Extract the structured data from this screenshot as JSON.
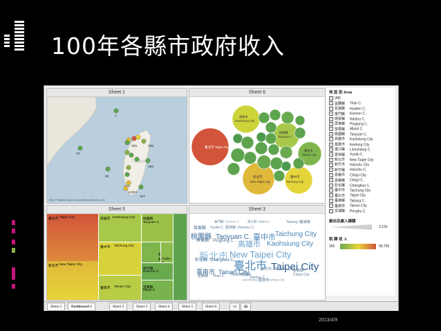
{
  "slide": {
    "title": "100年各縣市政府收入",
    "date": "2013/4/9"
  },
  "sheets": {
    "map": {
      "title": "Sheet 1",
      "labels": [
        "7",
        "43",
        "328",
        "335",
        "286",
        "50",
        "425",
        "2,834",
        "197"
      ],
      "watermark": "TAIWAN",
      "attribution": "Albert Tableau maps: www.tableausoftware.com"
    },
    "bubbles": {
      "title": "Sheet 6",
      "labels": [
        {
          "zh": "臺北市",
          "en": "Taipei City"
        },
        {
          "zh": "高雄市",
          "en": "Kaohsiung City"
        },
        {
          "zh": "桃園縣",
          "en": "Taoyuan C."
        },
        {
          "zh": "臺南市",
          "en": "Tainan City"
        },
        {
          "zh": "新北市",
          "en": "New Taipei City"
        },
        {
          "zh": "臺中市",
          "en": "Taichung City"
        }
      ]
    },
    "treemap": {
      "title": "Sheet 5",
      "cells": [
        {
          "zh": "臺北市",
          "en": "Taipei City"
        },
        {
          "zh": "高雄市",
          "en": "Kaohsiung City"
        },
        {
          "zh": "桃園縣",
          "en": "Taoyuan C."
        },
        {
          "zh": "新北市",
          "en": "New Taipei City"
        },
        {
          "zh": "臺中市",
          "en": "Taichung City"
        },
        {
          "zh": "臺南市",
          "en": "Tainan City"
        },
        {
          "zh": "苗栗縣",
          "en": "Yunlin C."
        },
        {
          "zh": "新竹縣",
          "en": "Hsinchu C."
        },
        {
          "zh": "宜蘭縣",
          "en": "Miaoli C."
        }
      ]
    },
    "wordcloud": {
      "title": "Sheet 3",
      "words": [
        {
          "t": "金門縣",
          "s": 4.5,
          "c": "#5a7a9a"
        },
        {
          "t": "Kinmen C.",
          "s": 4.5,
          "c": "#7a9ab0"
        },
        {
          "t": "連江縣",
          "s": 4.5,
          "c": "#6a8aa0"
        },
        {
          "t": "Miaoli C.",
          "s": 4.5,
          "c": "#6a8aa0"
        },
        {
          "t": "苗栗縣",
          "s": 6,
          "c": "#4a7090"
        },
        {
          "t": "Yunlin C.",
          "s": 5,
          "c": "#5a7a9a"
        },
        {
          "t": "雲林縣",
          "s": 5,
          "c": "#5a7a9a"
        },
        {
          "t": "Hsinchu C.",
          "s": 5,
          "c": "#5a7a9a"
        },
        {
          "t": "Taitung C.",
          "s": 5,
          "c": "#5a7a9a"
        },
        {
          "t": "臺東縣",
          "s": 5,
          "c": "#5a7a9a"
        },
        {
          "t": "桃園縣",
          "s": 10,
          "c": "#3a6a96"
        },
        {
          "t": "Taoyuan C.",
          "s": 10,
          "c": "#3a6a96"
        },
        {
          "t": "臺中市",
          "s": 11,
          "c": "#4a86b8"
        },
        {
          "t": "Taichung City",
          "s": 10,
          "c": "#4a86b8"
        },
        {
          "t": "屏東縣",
          "s": 6,
          "c": "#4a7090"
        },
        {
          "t": "Pingtung C.",
          "s": 6,
          "c": "#4a7090"
        },
        {
          "t": "高雄市",
          "s": 11,
          "c": "#6aa0cc"
        },
        {
          "t": "Kaohsiung City",
          "s": 10,
          "c": "#4a86b8"
        },
        {
          "t": "新北市",
          "s": 14,
          "c": "#8ab8dc"
        },
        {
          "t": "New Taipei City",
          "s": 13,
          "c": "#6aa0cc"
        },
        {
          "t": "彰化縣",
          "s": 6,
          "c": "#4a7090"
        },
        {
          "t": "Changhua C.",
          "s": 6,
          "c": "#4a7090"
        },
        {
          "t": "臺北市",
          "s": 16,
          "c": "#4a86b8"
        },
        {
          "t": "Taipei City",
          "s": 15,
          "c": "#2a5a8a"
        },
        {
          "t": "臺南市",
          "s": 9,
          "c": "#3a6a96"
        },
        {
          "t": "Tainan City",
          "s": 9,
          "c": "#3a6a96"
        },
        {
          "t": "宜蘭縣",
          "s": 5,
          "c": "#5a7a9a"
        },
        {
          "t": "Yilan C.",
          "s": 5,
          "c": "#5a7a9a"
        },
        {
          "t": "新竹市",
          "s": 5,
          "c": "#5a7a9a"
        },
        {
          "t": "Hsinchu City",
          "s": 5,
          "c": "#5a7a9a"
        },
        {
          "t": "嘉義縣",
          "s": 5,
          "c": "#5a7a9a"
        },
        {
          "t": "Chiayi City",
          "s": 5,
          "c": "#5a7a9a"
        },
        {
          "t": "Hualien C.",
          "s": 5,
          "c": "#5a7a9a"
        },
        {
          "t": "花蓮縣",
          "s": 5,
          "c": "#5a7a9a"
        },
        {
          "t": "Nantou C.",
          "s": 5,
          "c": "#5a7a9a"
        },
        {
          "t": "基隆市",
          "s": 5,
          "c": "#5a7a9a"
        },
        {
          "t": "Lienchiang C.",
          "s": 4.5,
          "c": "#7a9ab0"
        },
        {
          "t": "Keelung City",
          "s": 4.5,
          "c": "#7a9ab0"
        }
      ]
    }
  },
  "legend": {
    "header_zh": "地 區 別",
    "header_en": "Area",
    "items": [
      {
        "zh": "(All)",
        "en": ""
      },
      {
        "zh": "宜蘭縣",
        "en": "Yilan C."
      },
      {
        "zh": "花蓮縣",
        "en": "Hualien C."
      },
      {
        "zh": "金門縣",
        "en": "Kinmen C."
      },
      {
        "zh": "南投縣",
        "en": "Nantou C."
      },
      {
        "zh": "屏東縣",
        "en": "Pingtung C."
      },
      {
        "zh": "苗栗縣",
        "en": "Miaoli C."
      },
      {
        "zh": "桃園縣",
        "en": "Taoyuan C."
      },
      {
        "zh": "高雄市",
        "en": "Kaohsiung City"
      },
      {
        "zh": "基隆市",
        "en": "Keelung City"
      },
      {
        "zh": "連江縣",
        "en": "Lienchiang C."
      },
      {
        "zh": "雲林縣",
        "en": "Yunlin C."
      },
      {
        "zh": "新北市",
        "en": "New Taipei City"
      },
      {
        "zh": "新竹市",
        "en": "Hsinchu City"
      },
      {
        "zh": "新竹縣",
        "en": "Hsinchu C."
      },
      {
        "zh": "嘉義市",
        "en": "Chiayi City"
      },
      {
        "zh": "嘉義縣",
        "en": "Chiayi C."
      },
      {
        "zh": "彰化縣",
        "en": "Changhua C."
      },
      {
        "zh": "臺中市",
        "en": "Taichung City"
      },
      {
        "zh": "臺北市",
        "en": "Taipei City"
      },
      {
        "zh": "臺東縣",
        "en": "Taitung C."
      },
      {
        "zh": "臺南市",
        "en": "Tainan City"
      },
      {
        "zh": "澎湖縣",
        "en": "Penghu C."
      }
    ],
    "size_title": "歲出及歲入總額",
    "size_max": "3,153",
    "color_title": "稅 課 收 入",
    "color_min": "355",
    "color_max": "99,755"
  },
  "tabs": [
    "Sheet 1",
    "Dashboard 1",
    "Sheet 2",
    "Sheet 3",
    "Sheet 4",
    "Sheet 5",
    "Sheet 6"
  ],
  "colors": {
    "low": "#6aa84f",
    "mid": "#e6d53a",
    "high": "#d2553b"
  }
}
